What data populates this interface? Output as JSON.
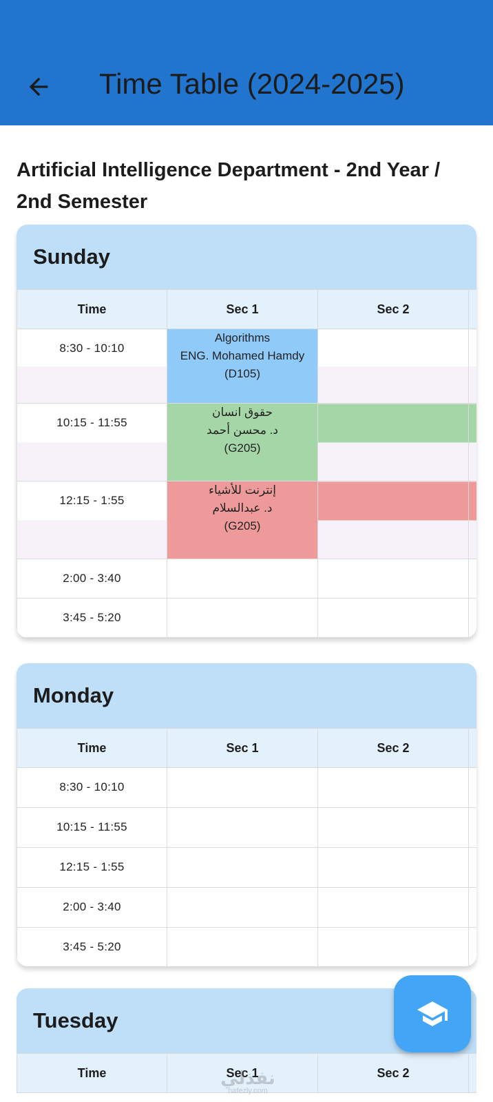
{
  "appbar": {
    "title": "Time Table (2024-2025)",
    "back_icon": "arrow-left-icon",
    "background_color": "#2175cf"
  },
  "department_title": "Artificial Intelligence Department - 2nd Year / 2nd Semester",
  "table_columns": {
    "time": "Time",
    "sec1": "Sec 1",
    "sec2": "Sec 2"
  },
  "colors": {
    "day_header": "#bfdff9",
    "table_header": "#e3f1fd",
    "slot_blue": "#90caf9",
    "slot_green": "#a5d6a7",
    "slot_red": "#ef9a9a",
    "fab": "#42a5f5"
  },
  "days": [
    {
      "name": "Sunday",
      "rows": [
        {
          "time": "8:30 - 10:10",
          "sec1": {
            "subject": "Algorithms",
            "instructor": "ENG. Mohamed Hamdy",
            "room": "(D105)"
          }
        },
        {
          "time": "10:15 - 11:55",
          "sec1": {
            "subject": "حقوق انسان",
            "instructor": "د. محسن أحمد",
            "room": "(G205)"
          }
        },
        {
          "time": "12:15 - 1:55",
          "sec1": {
            "subject": "إنترنت للأشياء",
            "instructor": "د. عبدالسلام",
            "room": "(G205)"
          }
        },
        {
          "time": "2:00 - 3:40"
        },
        {
          "time": "3:45 - 5:20"
        }
      ]
    },
    {
      "name": "Monday",
      "rows": [
        {
          "time": "8:30 - 10:10"
        },
        {
          "time": "10:15 - 11:55"
        },
        {
          "time": "12:15 - 1:55"
        },
        {
          "time": "2:00 - 3:40"
        },
        {
          "time": "3:45 - 5:20"
        }
      ]
    },
    {
      "name": "Tuesday",
      "rows": []
    }
  ],
  "fab": {
    "icon": "graduation-cap-icon"
  },
  "watermark": {
    "arabic": "نفذلي",
    "latin": "nafezly.com"
  }
}
